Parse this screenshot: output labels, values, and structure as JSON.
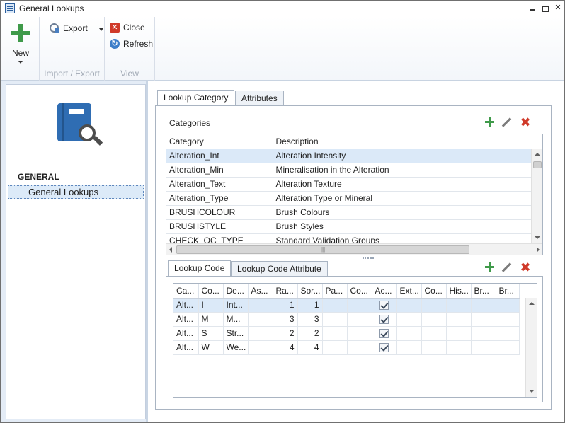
{
  "window": {
    "title": "General Lookups"
  },
  "ribbon": {
    "new_label": "New",
    "export_label": "Export",
    "close_label": "Close",
    "refresh_label": "Refresh",
    "group_import_export": "Import / Export",
    "group_view": "View",
    "close_glyph": "✕",
    "refresh_glyph": "↻"
  },
  "nav": {
    "heading": "GENERAL",
    "items": [
      {
        "label": "General Lookups"
      }
    ]
  },
  "tabs_top": [
    {
      "label": "Lookup Category"
    },
    {
      "label": "Attributes"
    }
  ],
  "categories": {
    "title": "Categories",
    "columns": [
      "Category",
      "Description"
    ],
    "rows": [
      {
        "category": "Alteration_Int",
        "description": "Alteration Intensity"
      },
      {
        "category": "Alteration_Min",
        "description": "Mineralisation in the Alteration"
      },
      {
        "category": "Alteration_Text",
        "description": "Alteration Texture"
      },
      {
        "category": "Alteration_Type",
        "description": "Alteration Type or Mineral"
      },
      {
        "category": "BRUSHCOLOUR",
        "description": "Brush Colours"
      },
      {
        "category": "BRUSHSTYLE",
        "description": "Brush Styles"
      },
      {
        "category": "CHECK_QC_TYPE",
        "description": "Standard Validation Groups"
      }
    ]
  },
  "tabs_bottom": [
    {
      "label": "Lookup Code"
    },
    {
      "label": "Lookup Code Attribute"
    }
  ],
  "codes": {
    "columns": [
      "Ca...",
      "Co...",
      "De...",
      "As...",
      "Ra...",
      "Sor...",
      "Pa...",
      "Co...",
      "Ac...",
      "Ext...",
      "Co...",
      "His...",
      "Br...",
      "Br..."
    ],
    "rows": [
      {
        "c0": "Alt...",
        "c1": "I",
        "c2": "Int...",
        "c4": "1",
        "c5": "1"
      },
      {
        "c0": "Alt...",
        "c1": "M",
        "c2": "M...",
        "c4": "3",
        "c5": "3"
      },
      {
        "c0": "Alt...",
        "c1": "S",
        "c2": "Str...",
        "c4": "2",
        "c5": "2"
      },
      {
        "c0": "Alt...",
        "c1": "W",
        "c2": "We...",
        "c4": "4",
        "c5": "4"
      }
    ]
  },
  "icons": {
    "delete_glyph": "✖"
  },
  "colors": {
    "accent_green": "#3f9a4a",
    "delete_red": "#d03a2a",
    "selection": "#dbe9f8"
  }
}
